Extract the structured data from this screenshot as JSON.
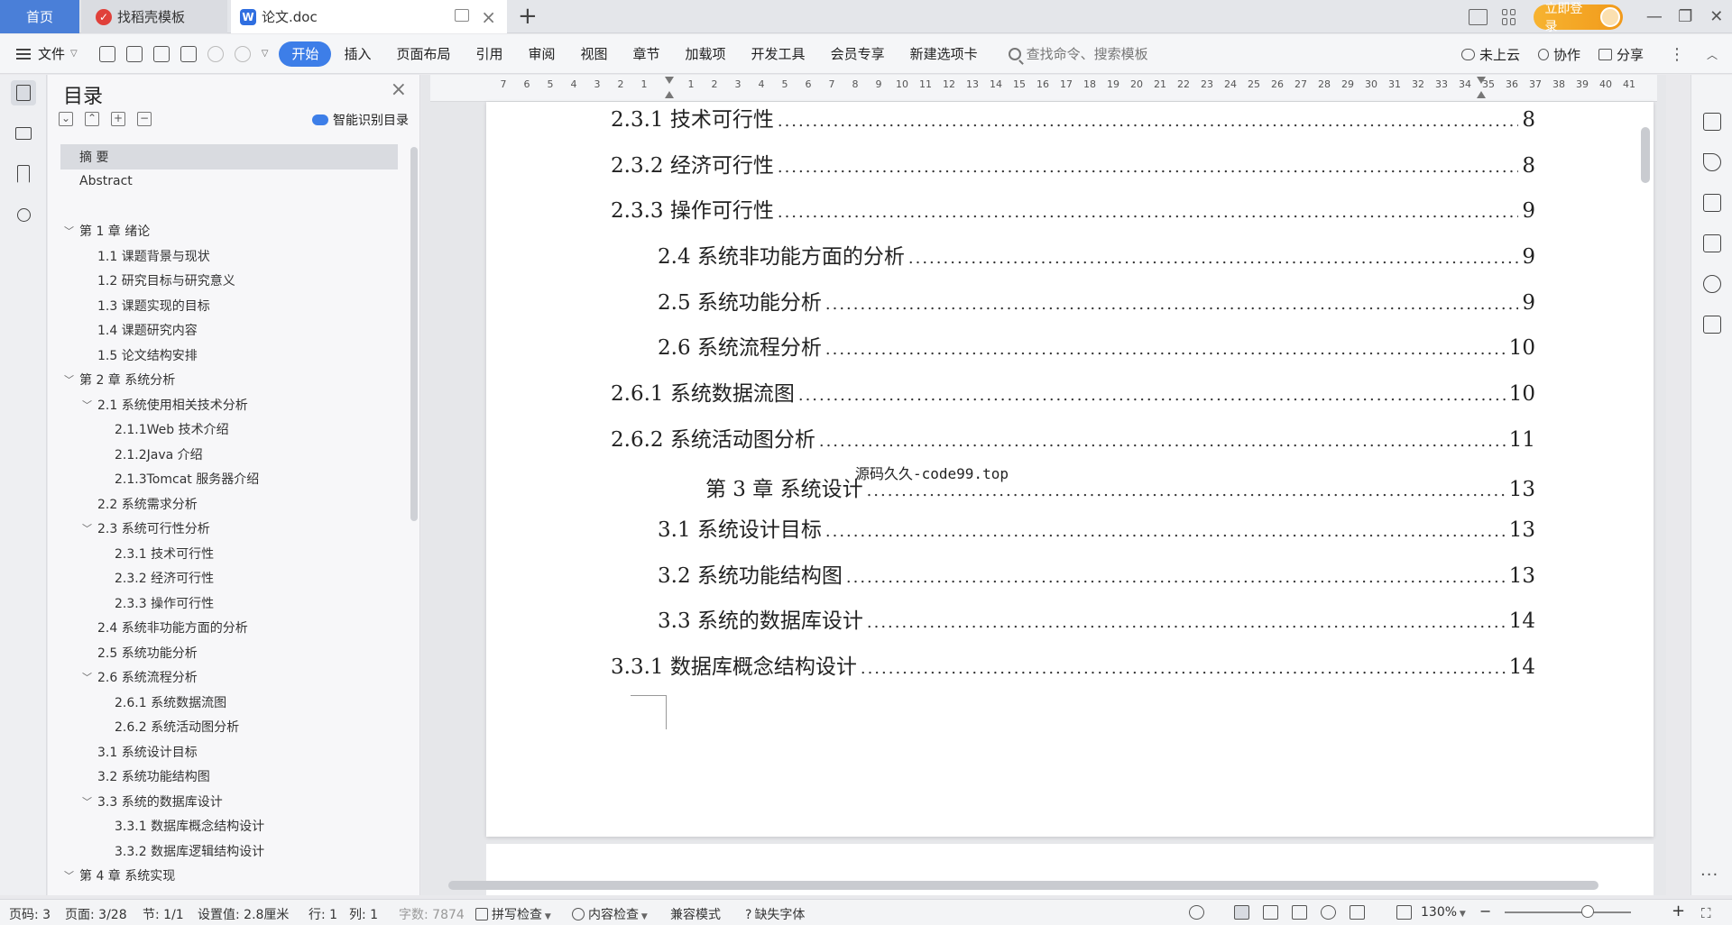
{
  "titlebar": {
    "tabs": [
      {
        "label": "首页"
      },
      {
        "label": "找稻壳模板"
      },
      {
        "label": "论文.doc"
      }
    ],
    "login_label": "立即登录"
  },
  "menubar": {
    "file_label": "文件",
    "items": [
      "开始",
      "插入",
      "页面布局",
      "引用",
      "审阅",
      "视图",
      "章节",
      "加载项",
      "开发工具",
      "会员专享",
      "新建选项卡"
    ],
    "active_item": "开始",
    "search_placeholder": "查找命令、搜索模板",
    "cloud_label": "未上云",
    "collab_label": "协作",
    "share_label": "分享"
  },
  "toc_panel": {
    "title": "目录",
    "smart_label": "智能识别目录",
    "items": [
      {
        "text": "摘  要",
        "level": 0,
        "caret": false,
        "selected": true
      },
      {
        "text": "Abstract",
        "level": 0,
        "caret": false,
        "selected": false
      },
      {
        "text": "",
        "level": 0,
        "caret": false,
        "selected": false
      },
      {
        "text": "第 1 章  绪论",
        "level": 0,
        "caret": true,
        "selected": false
      },
      {
        "text": "1.1 课题背景与现状",
        "level": 1,
        "caret": false,
        "selected": false
      },
      {
        "text": "1.2 研究目标与研究意义",
        "level": 1,
        "caret": false,
        "selected": false
      },
      {
        "text": "1.3 课题实现的目标",
        "level": 1,
        "caret": false,
        "selected": false
      },
      {
        "text": "1.4  课题研究内容",
        "level": 1,
        "caret": false,
        "selected": false
      },
      {
        "text": "1.5  论文结构安排",
        "level": 1,
        "caret": false,
        "selected": false
      },
      {
        "text": "第 2 章  系统分析",
        "level": 0,
        "caret": true,
        "selected": false
      },
      {
        "text": "2.1 系统使用相关技术分析",
        "level": 1,
        "caret": true,
        "selected": false
      },
      {
        "text": "2.1.1Web 技术介绍",
        "level": 2,
        "caret": false,
        "selected": false
      },
      {
        "text": "2.1.2Java 介绍",
        "level": 2,
        "caret": false,
        "selected": false
      },
      {
        "text": "2.1.3Tomcat 服务器介绍",
        "level": 2,
        "caret": false,
        "selected": false
      },
      {
        "text": "2.2 系统需求分析",
        "level": 1,
        "caret": false,
        "selected": false
      },
      {
        "text": "2.3 系统可行性分析",
        "level": 1,
        "caret": true,
        "selected": false
      },
      {
        "text": "2.3.1 技术可行性",
        "level": 2,
        "caret": false,
        "selected": false
      },
      {
        "text": "2.3.2 经济可行性",
        "level": 2,
        "caret": false,
        "selected": false
      },
      {
        "text": "2.3.3 操作可行性",
        "level": 2,
        "caret": false,
        "selected": false
      },
      {
        "text": "2.4 系统非功能方面的分析",
        "level": 1,
        "caret": false,
        "selected": false
      },
      {
        "text": "2.5 系统功能分析",
        "level": 1,
        "caret": false,
        "selected": false
      },
      {
        "text": "2.6 系统流程分析",
        "level": 1,
        "caret": true,
        "selected": false
      },
      {
        "text": "2.6.1 系统数据流图",
        "level": 2,
        "caret": false,
        "selected": false
      },
      {
        "text": "2.6.2 系统活动图分析",
        "level": 2,
        "caret": false,
        "selected": false
      },
      {
        "text": "3.1 系统设计目标",
        "level": 1,
        "caret": false,
        "selected": false
      },
      {
        "text": "3.2 系统功能结构图",
        "level": 1,
        "caret": false,
        "selected": false
      },
      {
        "text": "3.3 系统的数据库设计",
        "level": 1,
        "caret": true,
        "selected": false
      },
      {
        "text": "3.3.1 数据库概念结构设计",
        "level": 2,
        "caret": false,
        "selected": false
      },
      {
        "text": "3.3.2 数据库逻辑结构设计",
        "level": 2,
        "caret": false,
        "selected": false
      },
      {
        "text": "第 4 章  系统实现",
        "level": 0,
        "caret": true,
        "selected": false
      }
    ]
  },
  "ruler": {
    "left_numbers": [
      "7",
      "6",
      "5",
      "4",
      "3",
      "2",
      "1"
    ],
    "right_numbers": [
      "1",
      "2",
      "3",
      "4",
      "5",
      "6",
      "7",
      "8",
      "9",
      "10",
      "11",
      "12",
      "13",
      "14",
      "15",
      "16",
      "17",
      "18",
      "19",
      "20",
      "21",
      "22",
      "23",
      "24",
      "25",
      "26",
      "27",
      "28",
      "29",
      "30",
      "31",
      "32",
      "33",
      "34",
      "35",
      "36",
      "37",
      "38",
      "39",
      "40",
      "41"
    ]
  },
  "document": {
    "lines": [
      {
        "label": "2.3.1 技术可行性",
        "page": "8",
        "indent": 2
      },
      {
        "label": "2.3.2 经济可行性",
        "page": "8",
        "indent": 2
      },
      {
        "label": "2.3.3 操作可行性",
        "page": "9",
        "indent": 2
      },
      {
        "label": "2.4 系统非功能方面的分析",
        "page": "9",
        "indent": 1
      },
      {
        "label": "2.5 系统功能分析",
        "page": "9",
        "indent": 1
      },
      {
        "label": "2.6 系统流程分析",
        "page": "10",
        "indent": 1
      },
      {
        "label": "2.6.1 系统数据流图",
        "page": "10",
        "indent": 2
      },
      {
        "label": "2.6.2 系统活动图分析",
        "page": "11",
        "indent": 2
      },
      {
        "label": "第 3 章  系统设计",
        "page": "13",
        "indent": 0
      },
      {
        "label": "3.1 系统设计目标",
        "page": "13",
        "indent": 1
      },
      {
        "label": "3.2 系统功能结构图",
        "page": "13",
        "indent": 1
      },
      {
        "label": "3.3 系统的数据库设计",
        "page": "14",
        "indent": 1
      },
      {
        "label": "3.3.1 数据库概念结构设计",
        "page": "14",
        "indent": 2
      }
    ],
    "watermark": "源码久久-code99.top"
  },
  "statusbar": {
    "page_code": "页码: 3",
    "page": "页面: 3/28",
    "section": "节: 1/1",
    "setting": "设置值: 2.8厘米",
    "row": "行: 1",
    "col": "列: 1",
    "word_count": "字数: 7874",
    "spell_check": "拼写检查",
    "content_check": "内容检查",
    "compat_mode": "兼容模式",
    "missing_font": "缺失字体",
    "zoom": "130%"
  },
  "colors": {
    "accent": "#3d7ee8",
    "home_tab": "#4a7fd8",
    "login": "#f19a1b"
  }
}
